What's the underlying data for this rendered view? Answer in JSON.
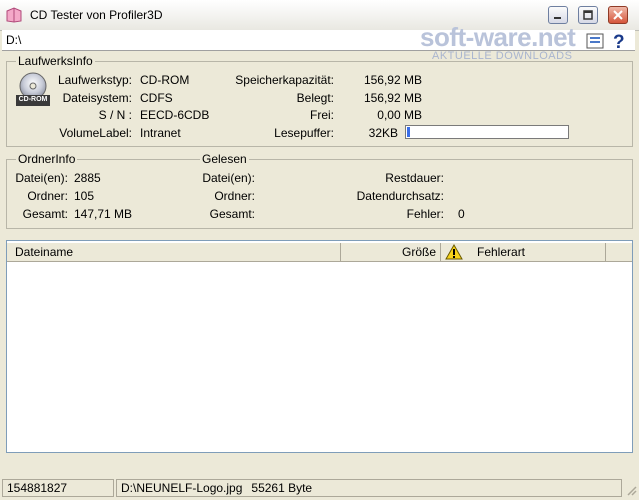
{
  "window": {
    "title": "CD Tester von Profiler3D",
    "icon": "app-icon",
    "controls": [
      "minimize-icon",
      "maximize-icon",
      "close-icon"
    ]
  },
  "path": "D:\\",
  "watermark": {
    "main": "soft-ware.net",
    "sub": "AKTUELLE DOWNLOADS"
  },
  "toolbar_icons": [
    "info-icon",
    "help-icon"
  ],
  "drive_info": {
    "legend": "LaufwerksInfo",
    "icon_label": "CD-ROM",
    "labels": {
      "type": "Laufwerkstyp:",
      "fs": "Dateisystem:",
      "sn": "S / N :",
      "volume": "VolumeLabel:",
      "capacity": "Speicherkapazität:",
      "used": "Belegt:",
      "free": "Frei:",
      "buffer": "Lesepuffer:"
    },
    "values": {
      "type": "CD-ROM",
      "fs": "CDFS",
      "sn": "EECD-6CDB",
      "volume": "Intranet",
      "capacity": "156,92 MB",
      "used": "156,92 MB",
      "free": "0,00 MB",
      "buffer": "32KB"
    },
    "buffer_fill": 0.02
  },
  "folder_info": {
    "legend": "OrdnerInfo",
    "labels": {
      "files": "Datei(en):",
      "folders": "Ordner:",
      "total": "Gesamt:"
    },
    "values": {
      "files": "2885",
      "folders": "105",
      "total": "147,71 MB"
    }
  },
  "read_info": {
    "legend": "Gelesen",
    "labels": {
      "files": "Datei(en):",
      "folders": "Ordner:",
      "total": "Gesamt:",
      "remaining": "Restdauer:",
      "throughput": "Datendurchsatz:",
      "errors": "Fehler:"
    },
    "values": {
      "errors": "0"
    }
  },
  "list": {
    "columns": {
      "name": "Dateiname",
      "size": "Größe",
      "error": "Fehlerart"
    },
    "warning_icon": "warning-icon"
  },
  "status": {
    "left": "154881827",
    "file": "D:\\NEUNELF-Logo.jpg",
    "size": "55261 Byte"
  },
  "colors": {
    "progress": "#3a6ee8",
    "list_border": "#7f9db9"
  }
}
